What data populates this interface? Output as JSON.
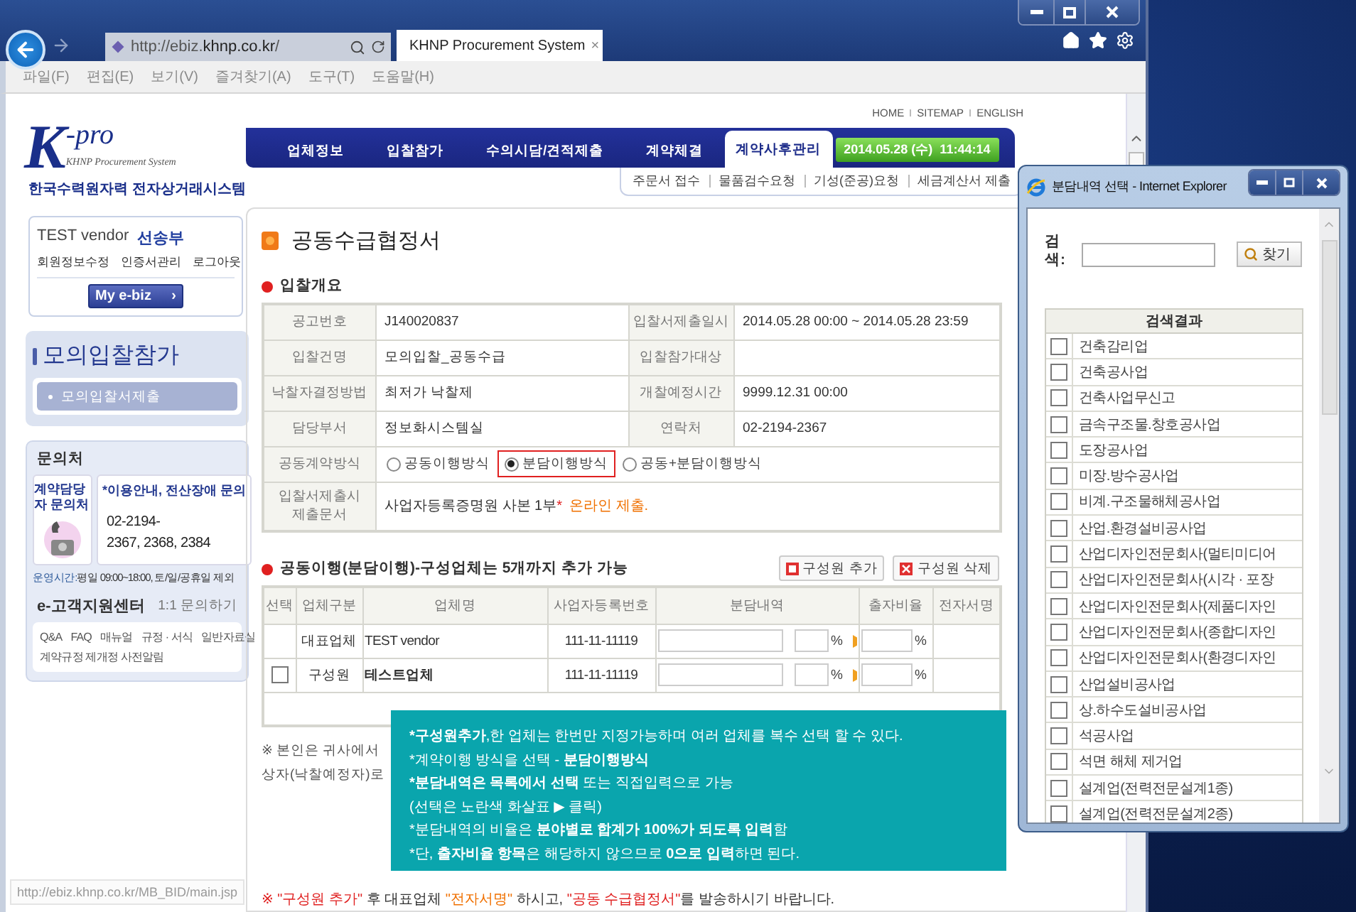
{
  "browser": {
    "address_prefix": "http://ebiz.",
    "address_domain": "khnp.co.kr",
    "address_suffix": "/",
    "tab_title": "KHNP Procurement System",
    "tab_close": "×",
    "menu": [
      "파일(F)",
      "편집(E)",
      "보기(V)",
      "즐겨찾기(A)",
      "도구(T)",
      "도움말(H)"
    ],
    "status_url": "http://ebiz.khnp.co.kr/MB_BID/main.jsp"
  },
  "header": {
    "logo_k": "K",
    "logo_pro": "-pro",
    "logo_sub": "KHNP Procurement System",
    "logo_korean": "한국수력원자력 전자상거래시스템",
    "top_links": [
      "HOME",
      "SITEMAP",
      "ENGLISH"
    ],
    "nav": [
      {
        "label": "업체정보",
        "selected": false
      },
      {
        "label": "입찰참가",
        "selected": false
      },
      {
        "label": "수의시담/견적제출",
        "selected": false
      },
      {
        "label": "계약체결",
        "selected": false
      },
      {
        "label": "계약사후관리",
        "selected": true
      }
    ],
    "clock": "2014.05.28 (수)  11:44:14",
    "subnav": [
      "주문서 접수",
      "물품검수요청",
      "기성(준공)요청",
      "세금계산서 제출"
    ]
  },
  "user": {
    "name": "TEST vendor",
    "role": "선송부",
    "links": [
      "회원정보수정",
      "인증서관리",
      "로그아웃"
    ],
    "myebiz": "My e-biz",
    "myebiz_arrow": "›"
  },
  "mock_bid": {
    "title": "모의입찰참가",
    "items": [
      "모의입찰서제출"
    ]
  },
  "contact": {
    "title": "문의처",
    "card_label": "계약담당자 문의처",
    "info_title": "*이용안내, 전산장애 문의",
    "phone_lines": [
      "02-2194-",
      "2367, 2368, 2384"
    ],
    "hours_label": "운영시간:",
    "hours": "평일 09:00~18:00, 토/일/공휴일 제외",
    "center_title": "e-고객지원센터",
    "center_link": "1:1 문의하기",
    "help_links": [
      "Q&A",
      "FAQ",
      "매뉴얼",
      "규정 · 서식",
      "일반자료실"
    ],
    "notice": "계약규정 제개정 사전알림"
  },
  "page": {
    "title": "공동수급협정서",
    "overview_title": "입찰개요",
    "overview": [
      {
        "label": "공고번호",
        "value": "J140020837",
        "label2": "입찰서제출일시",
        "value2": "2014.05.28 00:00 ~ 2014.05.28 23:59"
      },
      {
        "label": "입찰건명",
        "value": "모의입찰_공동수급",
        "label2": "입찰참가대상"
      },
      {
        "label": "낙찰자결정방법",
        "value": "최저가 낙찰제",
        "label2": "개찰예정시간",
        "value2": "9999.12.31 00:00"
      },
      {
        "label": "담당부서",
        "value": "정보화시스템실",
        "label2": "연락처",
        "value2": "02-2194-2367"
      }
    ],
    "contract_method": {
      "label": "공동계약방식",
      "options": [
        {
          "label": "공동이행방식",
          "selected": false
        },
        {
          "label": "분담이행방식",
          "selected": true
        },
        {
          "label": "공동+분담이행방식",
          "selected": false
        }
      ]
    },
    "documents": {
      "label": "입찰서제출시 제출문서",
      "value": "사업자등록증명원 사본 1부",
      "mark": "*",
      "note": "온라인 제출."
    },
    "members_title": "공동이행(분담이행)-구성업체는 5개까지 추가 가능",
    "add_button": "구성원 추가",
    "delete_button": "구성원 삭제",
    "columns": [
      "선택",
      "업체구분",
      "업체명",
      "사업자등록번호",
      "분담내역",
      "출자비율",
      "전자서명"
    ],
    "rows": [
      {
        "kind": "lead",
        "type": "대표업체",
        "name": "TEST vendor",
        "reg": "111-11-11119",
        "share_unit": "%",
        "ratio_unit": "%"
      },
      {
        "kind": "member",
        "checked": false,
        "type": "구성원",
        "name": "테스트업체",
        "reg": "111-11-11119",
        "share_unit": "%",
        "ratio_unit": "%"
      }
    ],
    "note_lines": [
      "※ 본인은 귀사에서",
      "상자(낙찰예정자)로"
    ],
    "footer": [
      {
        "kind": "red",
        "text": "※ \"구성원 추가\""
      },
      {
        "kind": "plain",
        "text": " 후 대표업체 "
      },
      {
        "kind": "orange",
        "text": "\"전자서명\""
      },
      {
        "kind": "plain",
        "text": " 하시고, "
      },
      {
        "kind": "red",
        "text": "\"공동 수급협정서\""
      },
      {
        "kind": "plain",
        "text": "를 발송하시기 바랍니다."
      }
    ]
  },
  "tip": [
    [
      {
        "text": "*구성원추가",
        "bold": true
      },
      {
        "text": ",한 업체는 한번만 지정가능하며 여러 업체를 복수 선택 할 수 있다.",
        "bold": false
      }
    ],
    [
      {
        "text": "*계약이행 방식을 선택 - ",
        "bold": false
      },
      {
        "text": "분담이행방식",
        "bold": true
      }
    ],
    [
      {
        "text": "*분담내역은 목록에서 선택",
        "bold": true
      },
      {
        "text": " 또는 직접입력으로 가능",
        "bold": false
      }
    ],
    [
      {
        "text": "(선택은 노란색 화살표 ▶ 클릭)",
        "bold": false
      }
    ],
    [
      {
        "text": "*분담내역의 비율은 ",
        "bold": false
      },
      {
        "text": "분야별로 합계가 100%가 되도록 입력",
        "bold": true
      },
      {
        "text": "함",
        "bold": false
      }
    ],
    [
      {
        "text": "*단, ",
        "bold": false
      },
      {
        "text": "출자비율 항목",
        "bold": true
      },
      {
        "text": "은 해당하지 않으므로 ",
        "bold": false
      },
      {
        "text": "0으로 입력",
        "bold": true
      },
      {
        "text": "하면 된다.",
        "bold": false
      }
    ]
  ],
  "popup": {
    "title": "분담내역 선택 - Internet Explorer",
    "search_label": "검색:",
    "search_button": "찾기",
    "results_header": "검색결과",
    "results": [
      {
        "label": "건축감리업",
        "checked": false
      },
      {
        "label": "건축공사업",
        "checked": false
      },
      {
        "label": "건축사업무신고",
        "checked": false
      },
      {
        "label": "금속구조물.창호공사업",
        "checked": false
      },
      {
        "label": "도장공사업",
        "checked": false
      },
      {
        "label": "미장.방수공사업",
        "checked": false
      },
      {
        "label": "비계.구조물해체공사업",
        "checked": false
      },
      {
        "label": "산업.환경설비공사업",
        "checked": false
      },
      {
        "label": "산업디자인전문회사(멀티미디어",
        "checked": false
      },
      {
        "label": "산업디자인전문회사(시각 · 포장",
        "checked": false
      },
      {
        "label": "산업디자인전문회사(제품디자인",
        "checked": false
      },
      {
        "label": "산업디자인전문회사(종합디자인",
        "checked": false
      },
      {
        "label": "산업디자인전문회사(환경디자인",
        "checked": false
      },
      {
        "label": "산업설비공사업",
        "checked": false
      },
      {
        "label": "상.하수도설비공사업",
        "checked": false
      },
      {
        "label": "석공사업",
        "checked": false
      },
      {
        "label": "석면 해체 제거업",
        "checked": false
      },
      {
        "label": "설계업(전력전문설계1종)",
        "checked": false
      },
      {
        "label": "설계업(전력전문설계2종)",
        "checked": false
      }
    ]
  }
}
